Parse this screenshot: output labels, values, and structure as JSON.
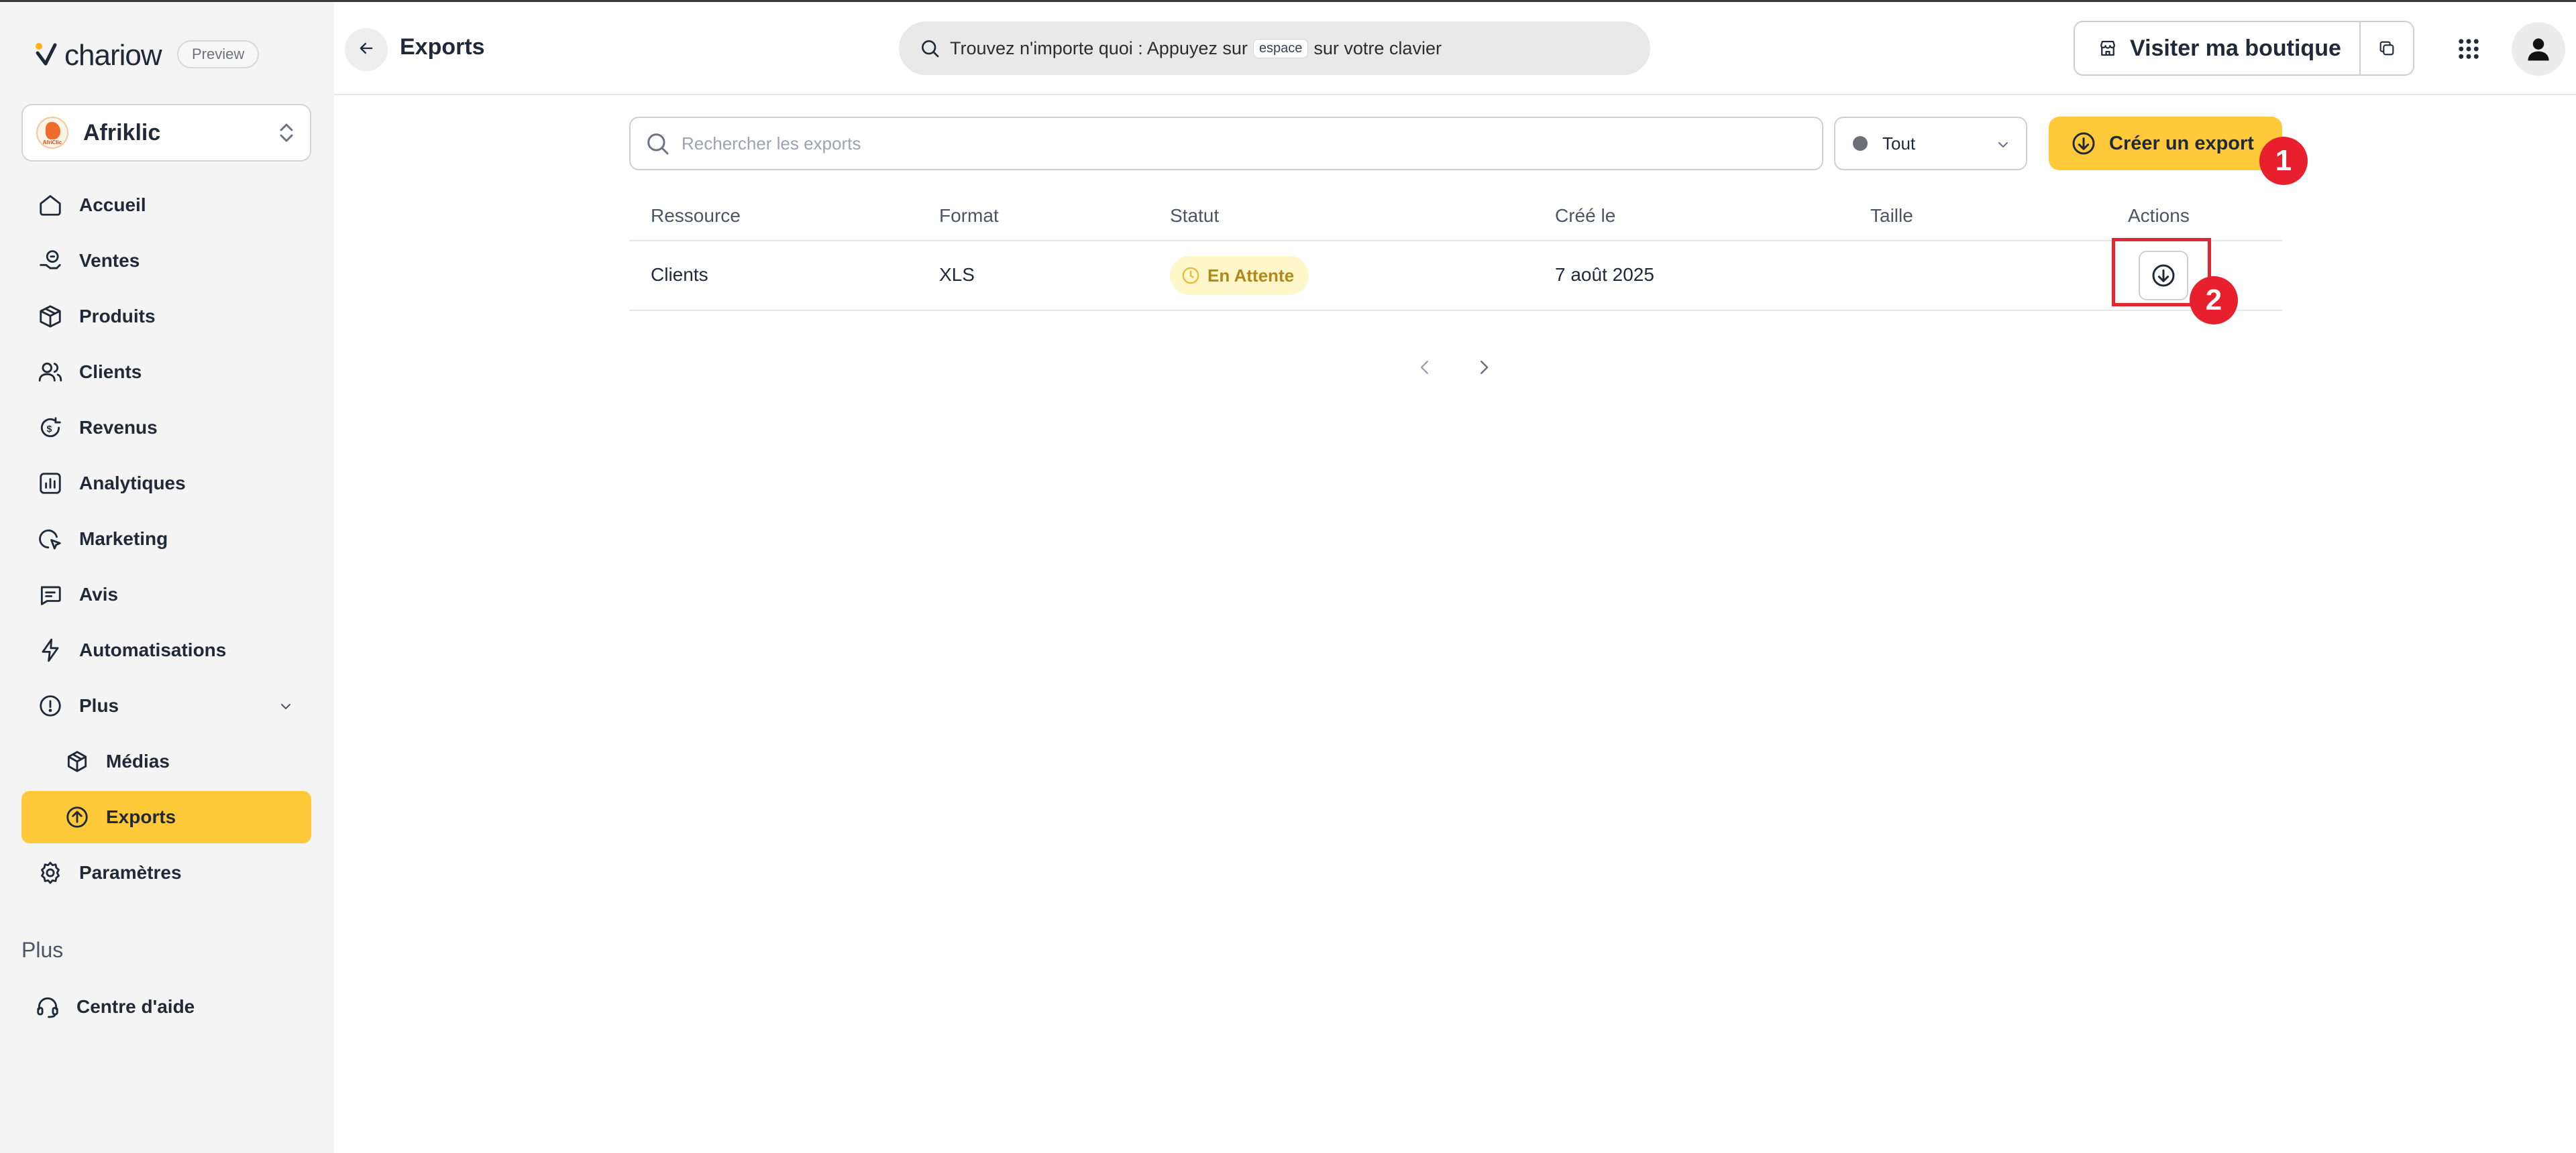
{
  "app": {
    "brand": "chariow",
    "badge": "Preview"
  },
  "store": {
    "name": "Afriklic",
    "avatar_text": "AfriClic"
  },
  "sidebar": {
    "items": [
      {
        "label": "Accueil",
        "icon": "home-icon"
      },
      {
        "label": "Ventes",
        "icon": "sales-icon"
      },
      {
        "label": "Produits",
        "icon": "box-icon"
      },
      {
        "label": "Clients",
        "icon": "users-icon"
      },
      {
        "label": "Revenus",
        "icon": "dollar-icon"
      },
      {
        "label": "Analytiques",
        "icon": "chart-icon"
      },
      {
        "label": "Marketing",
        "icon": "marketing-icon"
      },
      {
        "label": "Avis",
        "icon": "message-icon"
      },
      {
        "label": "Automatisations",
        "icon": "bolt-icon"
      },
      {
        "label": "Plus",
        "icon": "info-icon"
      }
    ],
    "sub_items": [
      {
        "label": "Médias",
        "icon": "media-icon"
      },
      {
        "label": "Exports",
        "icon": "upload-circle-icon",
        "active": true
      }
    ],
    "settings": {
      "label": "Paramètres",
      "icon": "gear-icon"
    },
    "section_label": "Plus",
    "help": {
      "label": "Centre d'aide",
      "icon": "headset-icon"
    }
  },
  "header": {
    "title": "Exports",
    "search_text_before": "Trouvez n'importe quoi : Appuyez sur",
    "search_kbd": "espace",
    "search_text_after": "sur votre clavier",
    "visit_label": "Visiter ma boutique"
  },
  "toolbar": {
    "search_placeholder": "Rechercher les exports",
    "filter_value": "Tout",
    "create_label": "Créer un export"
  },
  "annotations": [
    "1",
    "2"
  ],
  "table": {
    "columns": [
      "Ressource",
      "Format",
      "Statut",
      "Créé le",
      "Taille",
      "Actions"
    ],
    "rows": [
      {
        "resource": "Clients",
        "format": "XLS",
        "status": "En Attente",
        "created": "7 août 2025",
        "size": ""
      }
    ]
  },
  "colors": {
    "accent": "#ffc93a",
    "status_pending_bg": "#fff6c9",
    "status_pending_text": "#b3881a",
    "annotation_red": "#e8202e"
  }
}
